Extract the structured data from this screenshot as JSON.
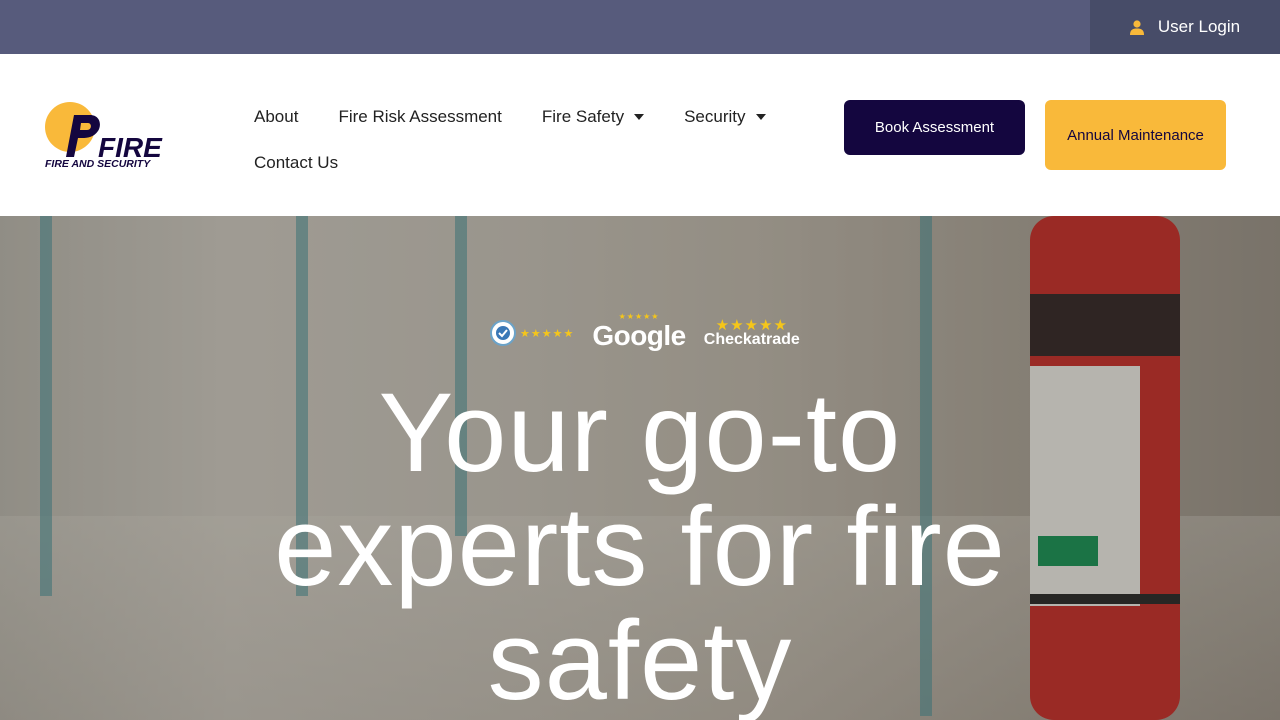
{
  "topbar": {
    "login_label": "User Login",
    "login_icon": "user-icon",
    "bg_color": "#575b7c",
    "login_bg_color": "#474c68",
    "icon_color": "#f9b93a"
  },
  "logo": {
    "wordmark": "FIRE",
    "tagline": "FIRE AND SECURITY",
    "accent_color": "#f9b93a",
    "brand_color": "#14063f"
  },
  "nav": {
    "items": [
      {
        "label": "About",
        "has_dropdown": false
      },
      {
        "label": "Fire Risk Assessment",
        "has_dropdown": false
      },
      {
        "label": "Fire Safety",
        "has_dropdown": true
      },
      {
        "label": "Security",
        "has_dropdown": true
      },
      {
        "label": "Contact Us",
        "has_dropdown": false
      }
    ]
  },
  "cta": {
    "book_label": "Book Assessment",
    "annual_label": "Annual Maintenance"
  },
  "hero": {
    "badges": {
      "trustpilot_stars": "★★★★★",
      "google_label": "Google",
      "google_stars": "★★★★★",
      "checkatrade_label": "Checkatrade",
      "checkatrade_stars": "★★★★★"
    },
    "headline_line1": "Your go-to",
    "headline_line2": "experts for fire",
    "headline_line3": "safety"
  }
}
